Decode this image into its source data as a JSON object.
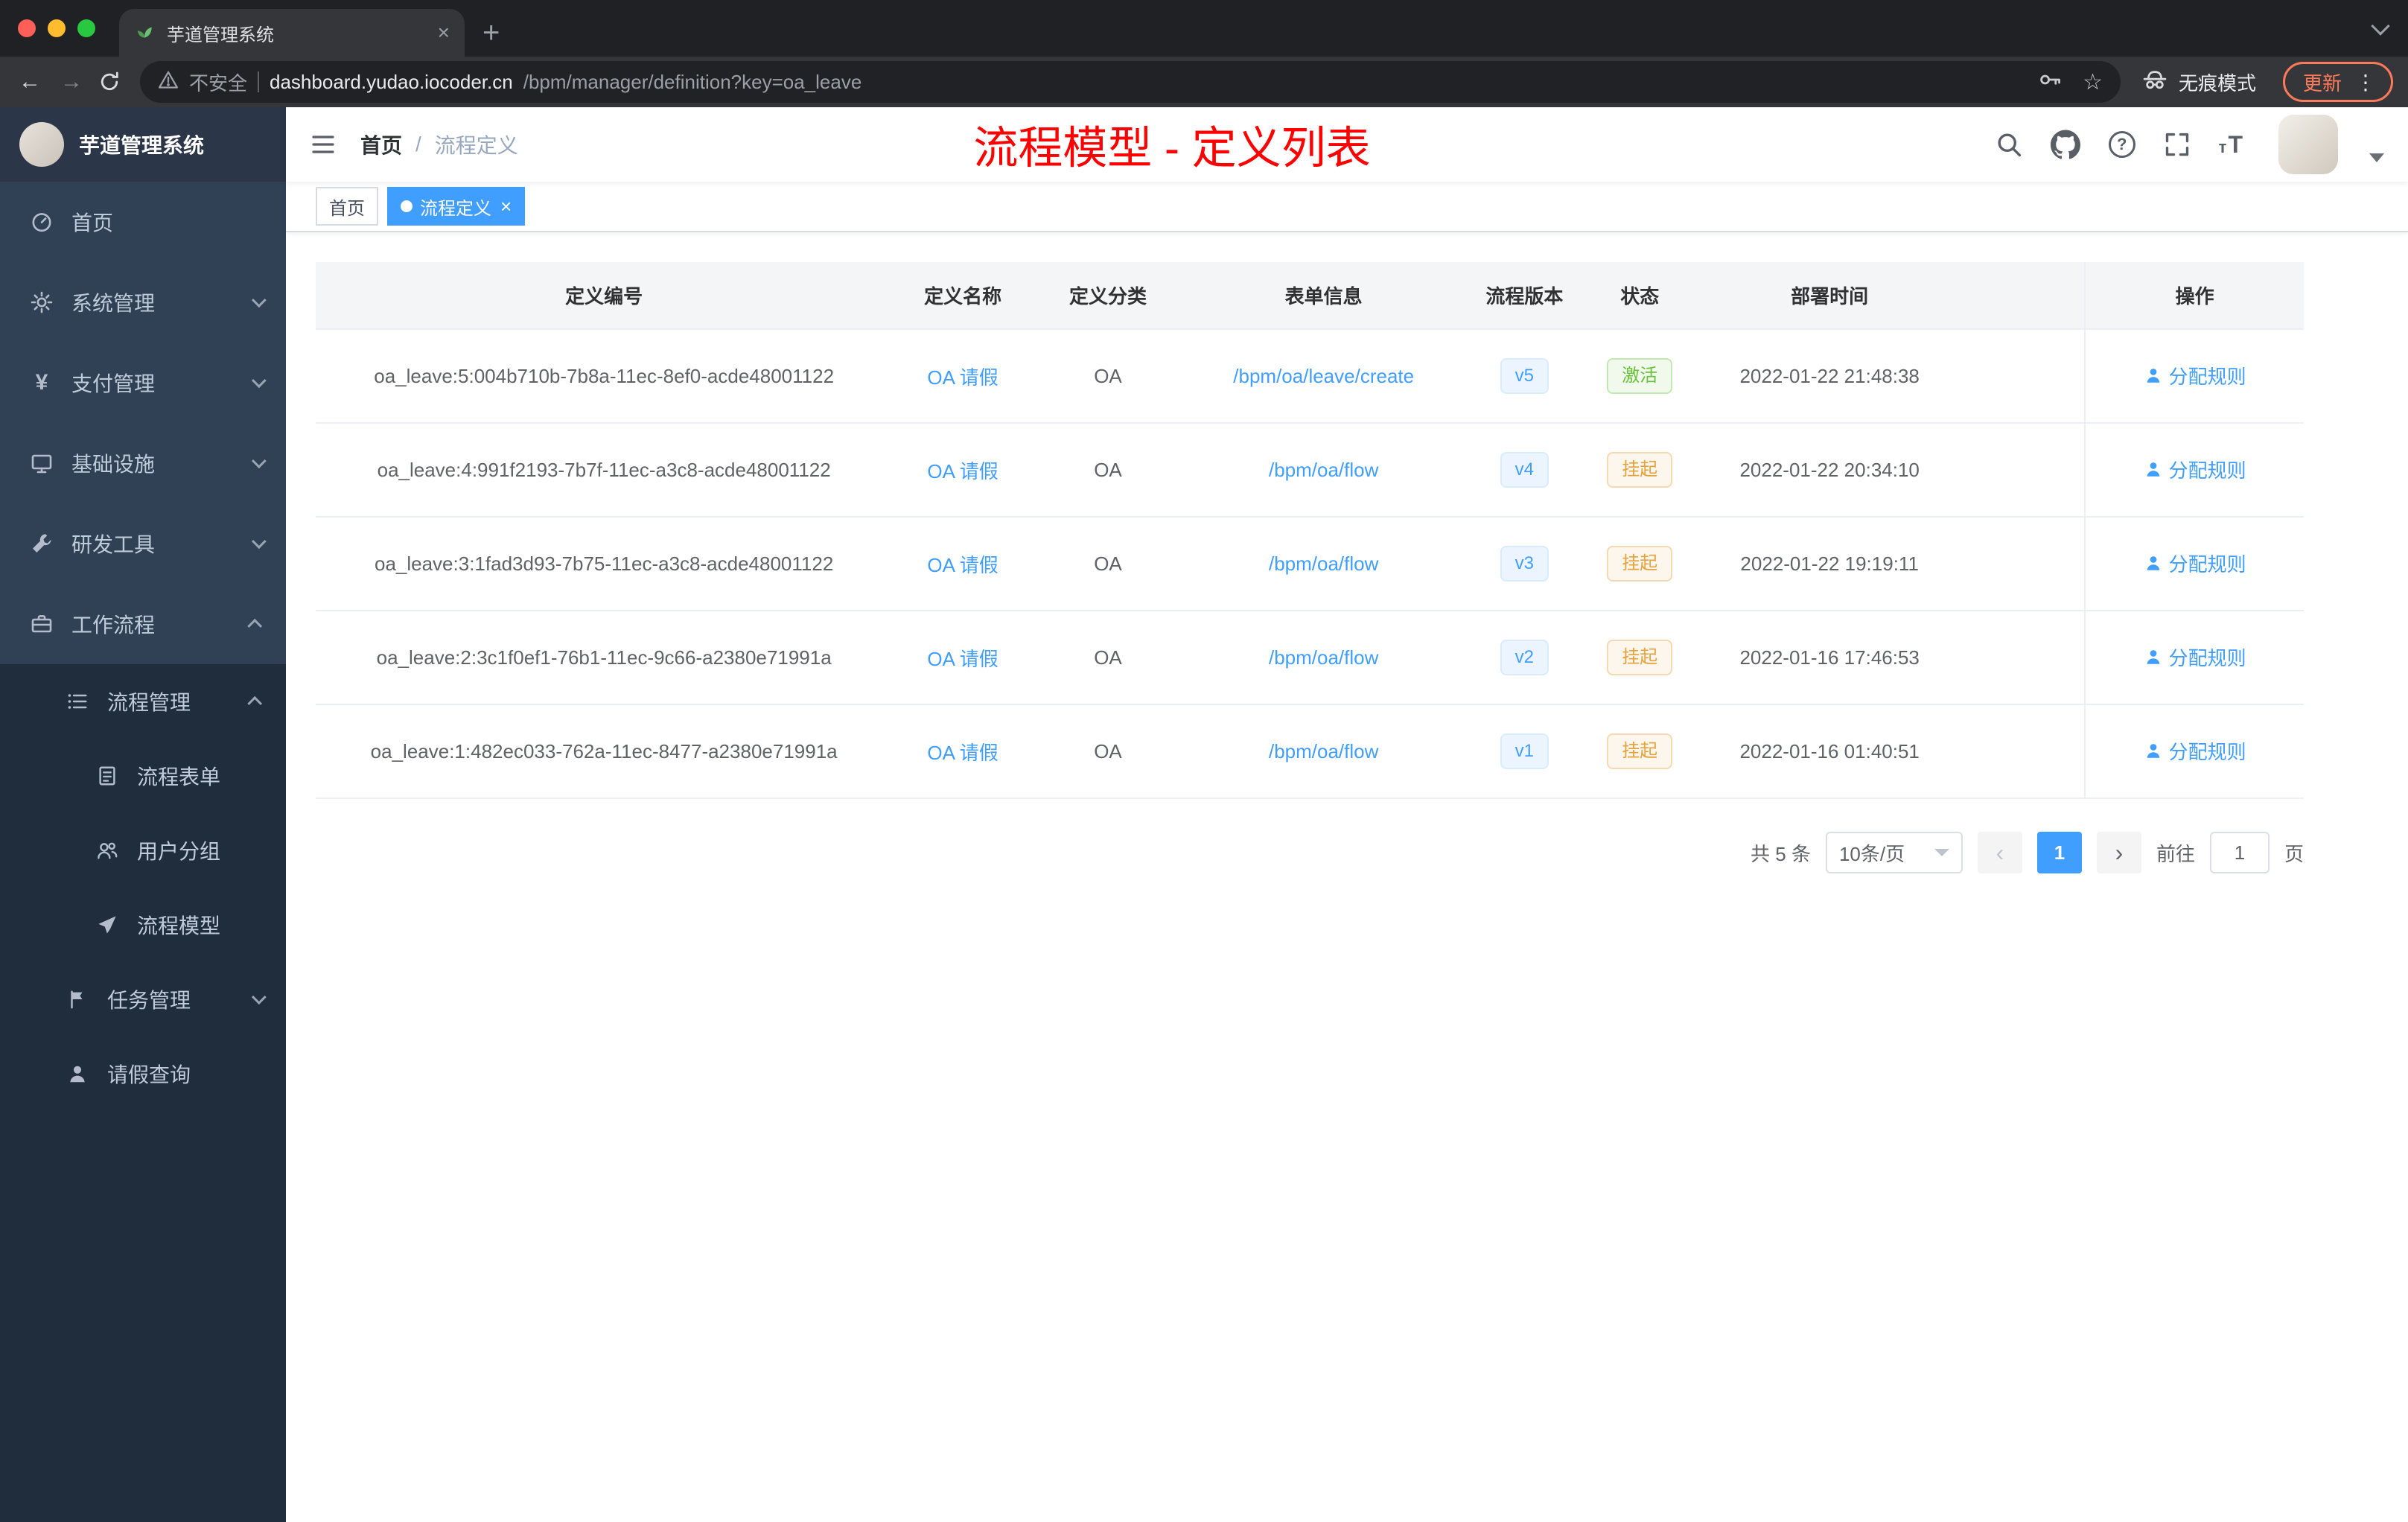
{
  "browser": {
    "tab_title": "芋道管理系统",
    "security_label": "不安全",
    "url_domain": "dashboard.yudao.iocoder.cn",
    "url_path": "/bpm/manager/definition?key=oa_leave",
    "incognito_label": "无痕模式",
    "update_label": "更新"
  },
  "icons": {
    "tab_favicon": "green-plant",
    "toolbar": [
      "back-arrow",
      "forward-arrow",
      "reload",
      "warning-triangle",
      "key",
      "star",
      "incognito",
      "menu-dots"
    ],
    "navbar": [
      "hamburger",
      "search",
      "github",
      "help",
      "fullscreen",
      "font-size",
      "caret-down"
    ],
    "action": "user"
  },
  "sidebar": {
    "logo_title": "芋道管理系统",
    "items": [
      {
        "label": "首页",
        "icon": "dashboard-gauge",
        "chevron": ""
      },
      {
        "label": "系统管理",
        "icon": "gear",
        "chevron": "down"
      },
      {
        "label": "支付管理",
        "icon": "yen",
        "chevron": "down"
      },
      {
        "label": "基础设施",
        "icon": "monitor",
        "chevron": "down"
      },
      {
        "label": "研发工具",
        "icon": "wrench",
        "chevron": "down"
      },
      {
        "label": "工作流程",
        "icon": "briefcase",
        "chevron": "up"
      }
    ],
    "submenu": [
      {
        "label": "流程管理",
        "icon": "list",
        "chevron": "up"
      },
      {
        "label": "流程表单",
        "icon": "form"
      },
      {
        "label": "用户分组",
        "icon": "users"
      },
      {
        "label": "流程模型",
        "icon": "paper-plane"
      },
      {
        "label": "任务管理",
        "icon": "flag",
        "chevron": "down"
      },
      {
        "label": "请假查询",
        "icon": "user"
      }
    ]
  },
  "header": {
    "breadcrumb_home": "首页",
    "breadcrumb_separator": "/",
    "breadcrumb_current": "流程定义",
    "overlay_title": "流程模型 - 定义列表",
    "overlay_color": "#ff0000"
  },
  "tags": [
    {
      "label": "首页",
      "active": false
    },
    {
      "label": "流程定义",
      "active": true
    }
  ],
  "table": {
    "columns": [
      "定义编号",
      "定义名称",
      "定义分类",
      "表单信息",
      "流程版本",
      "状态",
      "部署时间",
      "操作"
    ],
    "action_label": "分配规则",
    "rows": [
      {
        "id": "oa_leave:5:004b710b-7b8a-11ec-8ef0-acde48001122",
        "name": "OA 请假",
        "category": "OA",
        "form": "/bpm/oa/leave/create",
        "version": "v5",
        "status": "激活",
        "status_type": "success",
        "deployed": "2022-01-22 21:48:38"
      },
      {
        "id": "oa_leave:4:991f2193-7b7f-11ec-a3c8-acde48001122",
        "name": "OA 请假",
        "category": "OA",
        "form": "/bpm/oa/flow",
        "version": "v4",
        "status": "挂起",
        "status_type": "warning",
        "deployed": "2022-01-22 20:34:10"
      },
      {
        "id": "oa_leave:3:1fad3d93-7b75-11ec-a3c8-acde48001122",
        "name": "OA 请假",
        "category": "OA",
        "form": "/bpm/oa/flow",
        "version": "v3",
        "status": "挂起",
        "status_type": "warning",
        "deployed": "2022-01-22 19:19:11"
      },
      {
        "id": "oa_leave:2:3c1f0ef1-76b1-11ec-9c66-a2380e71991a",
        "name": "OA 请假",
        "category": "OA",
        "form": "/bpm/oa/flow",
        "version": "v2",
        "status": "挂起",
        "status_type": "warning",
        "deployed": "2022-01-16 17:46:53"
      },
      {
        "id": "oa_leave:1:482ec033-762a-11ec-8477-a2380e71991a",
        "name": "OA 请假",
        "category": "OA",
        "form": "/bpm/oa/flow",
        "version": "v1",
        "status": "挂起",
        "status_type": "warning",
        "deployed": "2022-01-16 01:40:51"
      }
    ]
  },
  "pagination": {
    "total_label": "共 5 条",
    "page_size": "10条/页",
    "current_page": "1",
    "goto_label": "前往",
    "goto_value": "1",
    "page_unit": "页"
  },
  "colors": {
    "accent_blue": "#409eff",
    "success_green": "#67c23a",
    "warning_orange": "#e6a23c",
    "overlay_red": "#ff0000",
    "sidebar_bg": "#304156",
    "submenu_bg": "#1f2d3d",
    "chrome_bg": "#202124"
  }
}
